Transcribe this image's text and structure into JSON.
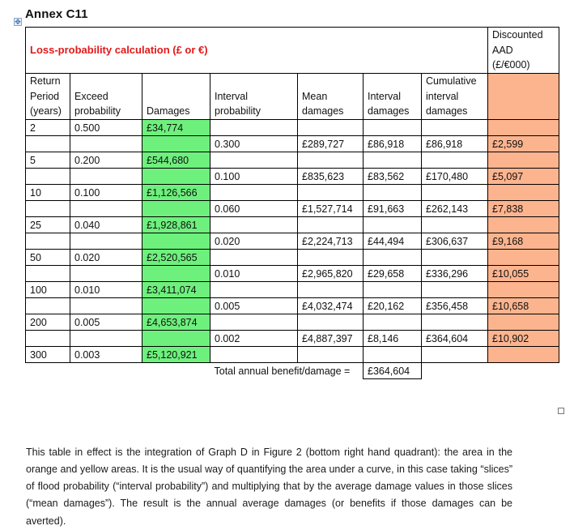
{
  "document": {
    "title": "Annex C11",
    "table_caption": "Loss-probability calculation (£ or €)",
    "discounted_header": [
      "Discounted",
      "AAD",
      "(£/€000)"
    ],
    "columns": [
      {
        "key": "return_period",
        "label": "Return Period (years)"
      },
      {
        "key": "exceed_probability",
        "label": "Exceed probability"
      },
      {
        "key": "damages",
        "label": "Damages"
      },
      {
        "key": "interval_probability",
        "label": "Interval probability"
      },
      {
        "key": "mean_damages",
        "label": "Mean damages"
      },
      {
        "key": "interval_damages",
        "label": "Interval damages"
      },
      {
        "key": "cumulative_interval_damages",
        "label": "Cumulative interval damages"
      },
      {
        "key": "discounted_aad",
        "label": ""
      }
    ],
    "rows": [
      {
        "return_period": "2",
        "exceed_probability": "0.500",
        "damages": "£34,774"
      },
      {
        "interval_probability": "0.300",
        "mean_damages": "£289,727",
        "interval_damages": "£86,918",
        "cumulative_interval_damages": "£86,918",
        "discounted_aad": "£2,599"
      },
      {
        "return_period": "5",
        "exceed_probability": "0.200",
        "damages": "£544,680"
      },
      {
        "interval_probability": "0.100",
        "mean_damages": "£835,623",
        "interval_damages": "£83,562",
        "cumulative_interval_damages": "£170,480",
        "discounted_aad": "£5,097"
      },
      {
        "return_period": "10",
        "exceed_probability": "0.100",
        "damages": "£1,126,566"
      },
      {
        "interval_probability": "0.060",
        "mean_damages": "£1,527,714",
        "interval_damages": "£91,663",
        "cumulative_interval_damages": "£262,143",
        "discounted_aad": "£7,838"
      },
      {
        "return_period": "25",
        "exceed_probability": "0.040",
        "damages": "£1,928,861"
      },
      {
        "interval_probability": "0.020",
        "mean_damages": "£2,224,713",
        "interval_damages": "£44,494",
        "cumulative_interval_damages": "£306,637",
        "discounted_aad": "£9,168"
      },
      {
        "return_period": "50",
        "exceed_probability": "0.020",
        "damages": "£2,520,565"
      },
      {
        "interval_probability": "0.010",
        "mean_damages": "£2,965,820",
        "interval_damages": "£29,658",
        "cumulative_interval_damages": "£336,296",
        "discounted_aad": "£10,055"
      },
      {
        "return_period": "100",
        "exceed_probability": "0.010",
        "damages": "£3,411,074"
      },
      {
        "interval_probability": "0.005",
        "mean_damages": "£4,032,474",
        "interval_damages": "£20,162",
        "cumulative_interval_damages": "£356,458",
        "discounted_aad": "£10,658"
      },
      {
        "return_period": "200",
        "exceed_probability": "0.005",
        "damages": "£4,653,874"
      },
      {
        "interval_probability": "0.002",
        "mean_damages": "£4,887,397",
        "interval_damages": "£8,146",
        "cumulative_interval_damages": "£364,604",
        "discounted_aad": "£10,902"
      },
      {
        "return_period": "300",
        "exceed_probability": "0.003",
        "damages": "£5,120,921"
      }
    ],
    "total": {
      "label": "Total annual benefit/damage =",
      "value": "£364,604"
    },
    "paragraph": "This table in effect is the integration of Graph D in Figure 2 (bottom right hand quadrant): the area in the orange and yellow areas. It is the usual way of quantifying the area under a curve, in this case taking “slices” of flood probability (“interval probability”) and multiplying that by the average damage values in those slices (“mean damages”). The result is the annual average damages (or benefits if those damages can be averted).",
    "colors": {
      "caption_red": "#e01a1a",
      "damages_green": "#6ef07d",
      "discounted_orange": "#fcb48f"
    },
    "icons": {
      "table_move_handle": "four-way-arrow",
      "table_resize_handle": "square"
    }
  }
}
